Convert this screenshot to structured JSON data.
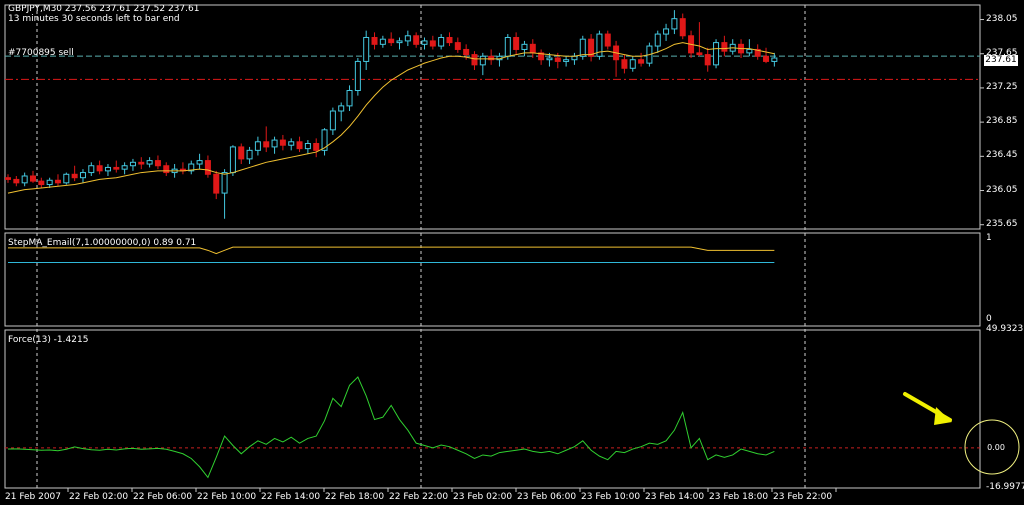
{
  "header": {
    "symbol_line": "GBPJPY,M30  237.56 237.61 237.52 237.61",
    "timer_line": "13 minutes 30 seconds left to bar end",
    "order_label": "#7700895 sell"
  },
  "panes": {
    "main_price_label": "237.61",
    "stepma_label": "StepMA_Email(7,1.00000000,0) 0.89 0.71",
    "force_label": "Force(13) -1.4215",
    "force_zero_label": "0.00"
  },
  "colors": {
    "background": "#000000",
    "bull_candle": "#44c8e0",
    "bear_candle": "#e01818",
    "ma_line": "#f0c030",
    "force_line": "#30d030",
    "order_line": "#e01818",
    "ask_line": "#5ab0b0",
    "arrow": "#f0f000"
  },
  "chart_data": [
    {
      "type": "candlestick",
      "title": "GBPJPY,M30",
      "y_ticks": [
        "238.05",
        "237.65",
        "237.25",
        "236.85",
        "236.45",
        "236.05",
        "235.65"
      ],
      "ylim": [
        235.6,
        238.22
      ],
      "current_price": 237.61,
      "order_price": 237.35,
      "x_ticks": [
        "21 Feb 2007",
        "22 Feb 02:00",
        "22 Feb 06:00",
        "22 Feb 10:00",
        "22 Feb 14:00",
        "22 Feb 18:00",
        "22 Feb 22:00",
        "23 Feb 02:00",
        "23 Feb 06:00",
        "23 Feb 10:00",
        "23 Feb 14:00",
        "23 Feb 18:00",
        "23 Feb 22:00"
      ],
      "ohlc": [
        [
          236.2,
          236.24,
          236.14,
          236.18
        ],
        [
          236.18,
          236.22,
          236.1,
          236.14
        ],
        [
          236.14,
          236.26,
          236.1,
          236.22
        ],
        [
          236.22,
          236.28,
          236.14,
          236.16
        ],
        [
          236.16,
          236.2,
          236.08,
          236.12
        ],
        [
          236.12,
          236.2,
          236.08,
          236.17
        ],
        [
          236.17,
          236.24,
          236.1,
          236.14
        ],
        [
          236.14,
          236.26,
          236.12,
          236.24
        ],
        [
          236.24,
          236.34,
          236.16,
          236.2
        ],
        [
          236.2,
          236.3,
          236.14,
          236.26
        ],
        [
          236.26,
          236.38,
          236.22,
          236.34
        ],
        [
          236.34,
          236.4,
          236.24,
          236.28
        ],
        [
          236.28,
          236.36,
          236.22,
          236.32
        ],
        [
          236.32,
          236.4,
          236.26,
          236.3
        ],
        [
          236.3,
          236.38,
          236.24,
          236.34
        ],
        [
          236.34,
          236.42,
          236.28,
          236.38
        ],
        [
          236.38,
          236.44,
          236.3,
          236.36
        ],
        [
          236.36,
          236.44,
          236.32,
          236.4
        ],
        [
          236.4,
          236.46,
          236.3,
          236.34
        ],
        [
          236.34,
          236.38,
          236.22,
          236.26
        ],
        [
          236.26,
          236.36,
          236.2,
          236.3
        ],
        [
          236.3,
          236.38,
          236.24,
          236.28
        ],
        [
          236.28,
          236.4,
          236.24,
          236.36
        ],
        [
          236.36,
          236.48,
          236.3,
          236.4
        ],
        [
          236.4,
          236.46,
          236.2,
          236.24
        ],
        [
          236.24,
          236.28,
          235.95,
          236.02
        ],
        [
          236.02,
          236.3,
          235.72,
          236.26
        ],
        [
          236.26,
          236.58,
          236.22,
          236.56
        ],
        [
          236.56,
          236.6,
          236.36,
          236.42
        ],
        [
          236.42,
          236.56,
          236.36,
          236.52
        ],
        [
          236.52,
          236.68,
          236.46,
          236.62
        ],
        [
          236.62,
          236.8,
          236.5,
          236.56
        ],
        [
          236.56,
          236.68,
          236.48,
          236.64
        ],
        [
          236.64,
          236.7,
          236.52,
          236.58
        ],
        [
          236.58,
          236.66,
          236.52,
          236.62
        ],
        [
          236.62,
          236.68,
          236.5,
          236.54
        ],
        [
          236.54,
          236.64,
          236.48,
          236.6
        ],
        [
          236.6,
          236.66,
          236.44,
          236.52
        ],
        [
          236.52,
          236.78,
          236.46,
          236.76
        ],
        [
          236.76,
          237.02,
          236.7,
          236.98
        ],
        [
          236.98,
          237.08,
          236.86,
          237.04
        ],
        [
          237.04,
          237.28,
          236.98,
          237.22
        ],
        [
          237.22,
          237.6,
          237.16,
          237.56
        ],
        [
          237.56,
          237.92,
          237.46,
          237.84
        ],
        [
          237.84,
          237.9,
          237.7,
          237.76
        ],
        [
          237.76,
          237.86,
          237.72,
          237.82
        ],
        [
          237.82,
          237.9,
          237.74,
          237.78
        ],
        [
          237.78,
          237.84,
          237.7,
          237.8
        ],
        [
          237.8,
          237.92,
          237.74,
          237.86
        ],
        [
          237.86,
          237.9,
          237.72,
          237.76
        ],
        [
          237.76,
          237.84,
          237.7,
          237.8
        ],
        [
          237.8,
          237.86,
          237.7,
          237.74
        ],
        [
          237.74,
          237.88,
          237.7,
          237.84
        ],
        [
          237.84,
          237.9,
          237.74,
          237.78
        ],
        [
          237.78,
          237.84,
          237.66,
          237.7
        ],
        [
          237.7,
          237.76,
          237.58,
          237.64
        ],
        [
          237.64,
          237.68,
          237.46,
          237.52
        ],
        [
          237.52,
          237.66,
          237.4,
          237.62
        ],
        [
          237.62,
          237.7,
          237.52,
          237.58
        ],
        [
          237.58,
          237.66,
          237.5,
          237.62
        ],
        [
          237.62,
          237.88,
          237.58,
          237.84
        ],
        [
          237.84,
          237.9,
          237.64,
          237.7
        ],
        [
          237.7,
          237.8,
          237.62,
          237.76
        ],
        [
          237.76,
          237.82,
          237.6,
          237.66
        ],
        [
          237.66,
          237.7,
          237.52,
          237.58
        ],
        [
          237.58,
          237.66,
          237.5,
          237.6
        ],
        [
          237.6,
          237.66,
          237.48,
          237.56
        ],
        [
          237.56,
          237.62,
          237.5,
          237.58
        ],
        [
          237.58,
          237.66,
          237.52,
          237.62
        ],
        [
          237.62,
          237.86,
          237.58,
          237.82
        ],
        [
          237.82,
          237.88,
          237.56,
          237.62
        ],
        [
          237.62,
          237.92,
          237.58,
          237.88
        ],
        [
          237.88,
          237.92,
          237.7,
          237.74
        ],
        [
          237.74,
          237.8,
          237.38,
          237.58
        ],
        [
          237.58,
          237.64,
          237.42,
          237.48
        ],
        [
          237.48,
          237.62,
          237.44,
          237.58
        ],
        [
          237.58,
          237.66,
          237.5,
          237.54
        ],
        [
          237.54,
          237.78,
          237.5,
          237.74
        ],
        [
          237.74,
          237.92,
          237.66,
          237.88
        ],
        [
          237.88,
          238.0,
          237.8,
          237.94
        ],
        [
          237.94,
          238.16,
          237.88,
          238.06
        ],
        [
          238.06,
          238.12,
          237.82,
          237.86
        ],
        [
          237.86,
          237.92,
          237.6,
          237.66
        ],
        [
          237.66,
          238.02,
          237.62,
          237.64
        ],
        [
          237.64,
          237.72,
          237.44,
          237.52
        ],
        [
          237.52,
          237.82,
          237.48,
          237.78
        ],
        [
          237.78,
          237.86,
          237.62,
          237.68
        ],
        [
          237.68,
          237.82,
          237.64,
          237.76
        ],
        [
          237.76,
          237.82,
          237.6,
          237.66
        ],
        [
          237.66,
          237.82,
          237.62,
          237.7
        ],
        [
          237.7,
          237.76,
          237.58,
          237.62
        ],
        [
          237.62,
          237.72,
          237.54,
          237.56
        ],
        [
          237.56,
          237.66,
          237.5,
          237.6
        ]
      ],
      "ma": [
        236.02,
        236.04,
        236.06,
        236.07,
        236.08,
        236.09,
        236.1,
        236.11,
        236.12,
        236.14,
        236.16,
        236.18,
        236.19,
        236.2,
        236.22,
        236.24,
        236.26,
        236.27,
        236.28,
        236.28,
        236.28,
        236.28,
        236.29,
        236.3,
        236.29,
        236.26,
        236.24,
        236.26,
        236.29,
        236.32,
        236.35,
        236.38,
        236.4,
        236.42,
        236.44,
        236.46,
        236.48,
        236.5,
        236.55,
        236.62,
        236.7,
        236.8,
        236.92,
        237.05,
        237.16,
        237.26,
        237.34,
        237.4,
        237.46,
        237.5,
        237.54,
        237.57,
        237.6,
        237.62,
        237.62,
        237.61,
        237.59,
        237.59,
        237.59,
        237.59,
        237.62,
        237.64,
        237.66,
        237.66,
        237.65,
        237.64,
        237.63,
        237.62,
        237.62,
        237.64,
        237.64,
        237.67,
        237.68,
        237.66,
        237.64,
        237.62,
        237.62,
        237.64,
        237.67,
        237.71,
        237.76,
        237.78,
        237.76,
        237.74,
        237.7,
        237.71,
        237.71,
        237.72,
        237.71,
        237.71,
        237.69,
        237.67,
        237.65
      ]
    },
    {
      "type": "line",
      "title": "StepMA_Email(7,1.00000000,0) 0.89 0.71",
      "y_ticks": [
        "1",
        "0"
      ],
      "ylim": [
        0,
        1
      ],
      "series": [
        {
          "name": "",
          "values": [
            0.89,
            0.89,
            0.89,
            0.89,
            0.89,
            0.89,
            0.89,
            0.89,
            0.89,
            0.89,
            0.89,
            0.89,
            0.89,
            0.89,
            0.89,
            0.89,
            0.89,
            0.89,
            0.89,
            0.89,
            0.89,
            0.89,
            0.89,
            0.89,
            0.86,
            0.82,
            0.86,
            0.9,
            0.9,
            0.9,
            0.9,
            0.9,
            0.9,
            0.9,
            0.9,
            0.9,
            0.9,
            0.9,
            0.9,
            0.9,
            0.9,
            0.9,
            0.9,
            0.9,
            0.9,
            0.9,
            0.9,
            0.9,
            0.9,
            0.9,
            0.9,
            0.9,
            0.9,
            0.9,
            0.9,
            0.9,
            0.9,
            0.9,
            0.9,
            0.9,
            0.9,
            0.9,
            0.9,
            0.9,
            0.9,
            0.9,
            0.9,
            0.9,
            0.9,
            0.9,
            0.9,
            0.9,
            0.9,
            0.9,
            0.9,
            0.9,
            0.9,
            0.9,
            0.9,
            0.9,
            0.9,
            0.9,
            0.9,
            0.88,
            0.86,
            0.86,
            0.86,
            0.86,
            0.86,
            0.86,
            0.86,
            0.86,
            0.86
          ]
        },
        {
          "name": "",
          "values": [
            0.71,
            0.71,
            0.71,
            0.71,
            0.71,
            0.71,
            0.71,
            0.71,
            0.71,
            0.71,
            0.71,
            0.71,
            0.71,
            0.71,
            0.71,
            0.71,
            0.71,
            0.71,
            0.71,
            0.71,
            0.71,
            0.71,
            0.71,
            0.71,
            0.71,
            0.71,
            0.71,
            0.71,
            0.71,
            0.71,
            0.71,
            0.71,
            0.71,
            0.71,
            0.71,
            0.71,
            0.71,
            0.71,
            0.71,
            0.71,
            0.71,
            0.71,
            0.71,
            0.71,
            0.71,
            0.71,
            0.71,
            0.71,
            0.71,
            0.71,
            0.71,
            0.71,
            0.71,
            0.71,
            0.71,
            0.71,
            0.71,
            0.71,
            0.71,
            0.71,
            0.71,
            0.71,
            0.71,
            0.71,
            0.71,
            0.71,
            0.71,
            0.71,
            0.71,
            0.71,
            0.71,
            0.71,
            0.71,
            0.71,
            0.71,
            0.71,
            0.71,
            0.71,
            0.71,
            0.71,
            0.71,
            0.71,
            0.71,
            0.71,
            0.71,
            0.71,
            0.71,
            0.71,
            0.71,
            0.71,
            0.71,
            0.71,
            0.71
          ]
        }
      ]
    },
    {
      "type": "line",
      "title": "Force(13) -1.4215",
      "y_ticks": [
        "49.9323",
        "0.00",
        "-16.9977"
      ],
      "ylim": [
        -16.9977,
        49.9323
      ],
      "series": [
        {
          "name": "",
          "values": [
            -0.5,
            -0.4,
            -0.6,
            -0.8,
            -1.0,
            -0.9,
            -1.2,
            -0.6,
            0.4,
            -0.3,
            -0.8,
            -1.0,
            -0.6,
            -0.9,
            -0.4,
            -0.2,
            -0.6,
            -0.4,
            -0.2,
            -0.6,
            -1.5,
            -2.5,
            -4.5,
            -8.0,
            -12.5,
            -4.0,
            5.0,
            1.0,
            -2.5,
            0.5,
            3.0,
            1.5,
            4.0,
            2.5,
            4.5,
            2.0,
            4.0,
            5.0,
            11.5,
            21.0,
            17.5,
            26.5,
            30.0,
            22.0,
            12.0,
            13.0,
            18.0,
            12.0,
            7.5,
            2.0,
            1.0,
            0.0,
            1.2,
            0.5,
            -1.0,
            -2.5,
            -4.5,
            -3.0,
            -3.5,
            -2.0,
            -1.5,
            -1.0,
            -0.5,
            -1.5,
            -2.0,
            -1.5,
            -2.5,
            -1.0,
            0.5,
            3.0,
            -1.0,
            -3.5,
            -5.0,
            -1.5,
            -2.0,
            -0.5,
            0.5,
            2.0,
            1.5,
            3.0,
            7.5,
            15.0,
            0.0,
            4.0,
            -5.0,
            -3.0,
            -4.0,
            -3.0,
            -0.5,
            -1.5,
            -2.5,
            -3.0,
            -1.5
          ]
        }
      ]
    }
  ]
}
